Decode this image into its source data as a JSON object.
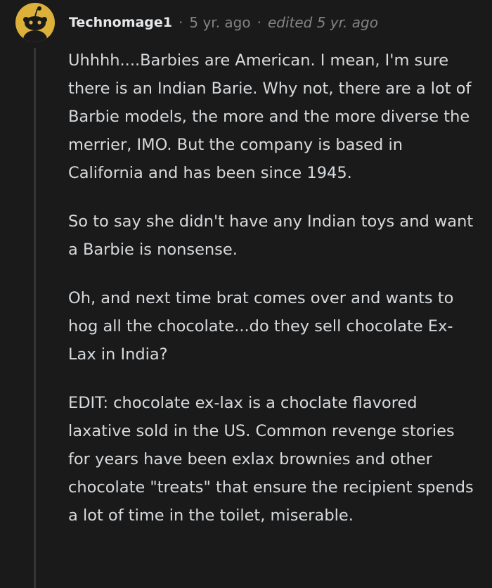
{
  "comment": {
    "username": "Technomage1",
    "separator": "·",
    "timestamp": "5 yr. ago",
    "edited": "edited 5 yr. ago",
    "avatar_icon": "snoo-avatar-icon",
    "avatar_color": "#dbb13a",
    "paragraphs": [
      "Uhhhh....Barbies are American. I mean, I'm sure there is an Indian Barie. Why not, there are a lot of Barbie models, the more and the more diverse the merrier, IMO. But the company is based in California and has been since 1945.",
      "So to say she didn't have any Indian toys and want a Barbie is nonsense.",
      "Oh, and next time brat comes over and wants to hog all the chocolate...do they sell chocolate Ex-Lax in India?",
      "EDIT: chocolate ex-lax is a choclate flavored laxative sold in the US. Common revenge stories for years have been exlax brownies and other chocolate \"treats\" that ensure the recipient spends a lot of time in the toilet, miserable."
    ]
  }
}
